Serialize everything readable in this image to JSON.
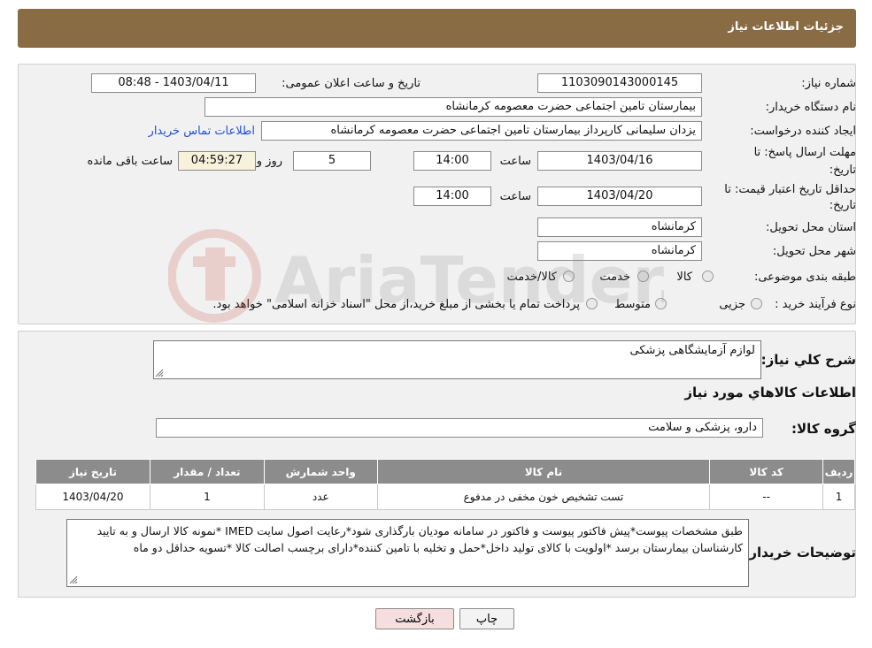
{
  "header": {
    "title": "جزئیات اطلاعات نیاز"
  },
  "need": {
    "number_label": "شماره نیاز:",
    "number_value": "1103090143000145",
    "announce_label": "تاریخ و ساعت اعلان عمومی:",
    "announce_value": "1403/04/11 - 08:48",
    "buyer_label": "نام دستگاه خریدار:",
    "buyer_value": "بیمارستان تامین اجتماعی حضرت معصومه کرمانشاه",
    "creator_label": "ایجاد کننده درخواست:",
    "creator_value": "یزدان  سلیمانی کارپرداز بیمارستان تامین اجتماعی حضرت معصومه کرمانشاه",
    "contact_link": "اطلاعات تماس خریدار",
    "deadline_label_1": "مهلت ارسال پاسخ: تا",
    "deadline_label_2": "تاریخ:",
    "deadline_date": "1403/04/16",
    "time_label": "ساعت",
    "deadline_time": "14:00",
    "days_value": "5",
    "days_label": "روز و",
    "remaining_value": "04:59:27",
    "remaining_label": "ساعت باقی مانده",
    "validity_label_1": "حداقل تاریخ اعتبار قیمت: تا",
    "validity_label_2": "تاریخ:",
    "validity_date": "1403/04/20",
    "validity_time": "14:00",
    "province_label": "استان محل تحویل:",
    "province_value": "کرمانشاه",
    "city_label": "شهر محل تحویل:",
    "city_value": "کرمانشاه",
    "category_label": "طبقه بندی موضوعی:",
    "category_options": [
      "کالا",
      "خدمت",
      "کالا/خدمت"
    ],
    "process_label": "نوع فرآیند خرید :",
    "process_options": [
      "جزیی",
      "متوسط"
    ],
    "process_note": "پرداخت تمام یا بخشی از مبلغ خرید،از محل \"اسناد خزانه اسلامی\" خواهد بود."
  },
  "details": {
    "summary_label": "شرح کلي نیاز:",
    "summary_value": "لوازم آزمایشگاهی پزشکی",
    "goods_title": "اطلاعات کالاهاي مورد نیاز",
    "group_label": "گروه کالا:",
    "group_value": "دارو، پزشکی و سلامت",
    "table": {
      "headers": [
        "ردیف",
        "کد کالا",
        "نام کالا",
        "واحد شمارش",
        "تعداد / مقدار",
        "تاریخ نیاز"
      ],
      "rows": [
        [
          "1",
          "--",
          "تست تشخیص خون مخفی در مدفوع",
          "عدد",
          "1",
          "1403/04/20"
        ]
      ]
    },
    "buyer_notes_label": "توضیحات خریدار:",
    "buyer_notes_value": "طبق مشخصات پیوست*پیش فاکتور پیوست و فاکتور در سامانه مودیان بارگذاری شود*رعایت اصول سایت IMED *نمونه کالا ارسال و به تایید کارشناسان بیمارستان برسد *اولویت با کالای تولید داخل*حمل و تخلیه با تامین کننده*دارای برچسب اصالت کالا *تسویه حداقل دو ماه"
  },
  "actions": {
    "print_label": "چاپ",
    "back_label": "بازگشت"
  },
  "watermark": {
    "text": "AriaTender.neT"
  },
  "colors": {
    "header_bg": "#8a6c44",
    "table_header_bg": "#8c8c8c",
    "link": "#1f4fd8",
    "back_button_bg": "#f6dede"
  }
}
